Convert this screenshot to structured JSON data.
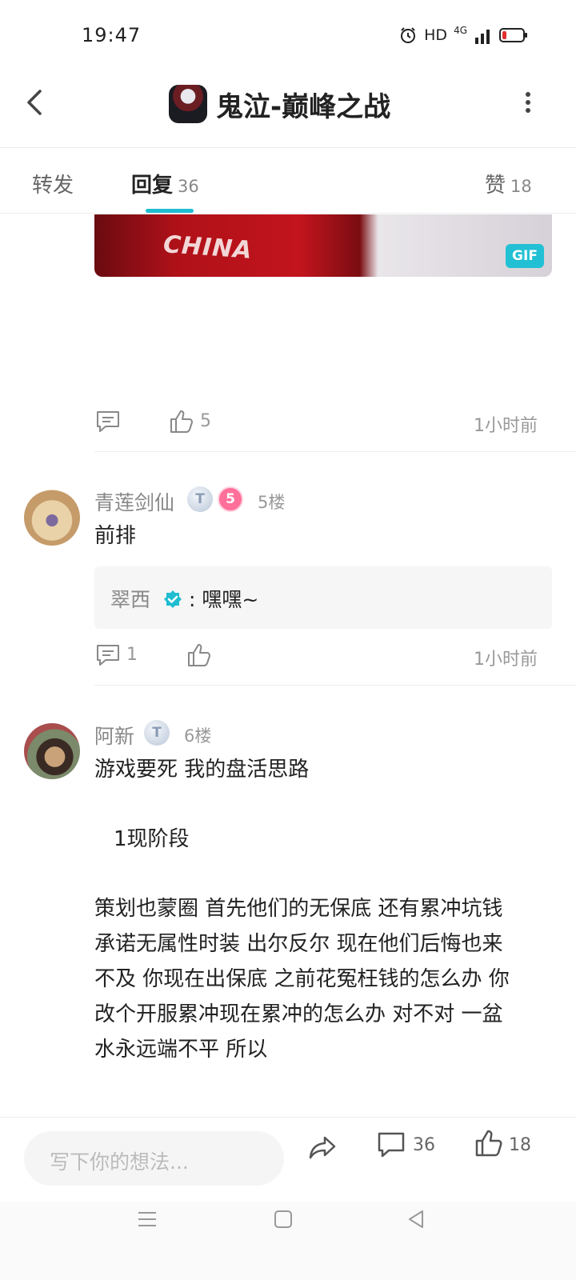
{
  "status_bar": {
    "time": "19:47",
    "hd": "HD",
    "signal": "4G"
  },
  "header": {
    "title": "鬼泣-巅峰之战"
  },
  "tabs": [
    {
      "label": "转发",
      "count": ""
    },
    {
      "label": "回复",
      "count": "36"
    },
    {
      "label": "赞",
      "count": "18"
    }
  ],
  "gif": {
    "text": "CHINA",
    "badge": "GIF"
  },
  "post4": {
    "like_count": "5",
    "time": "1小时前"
  },
  "comment5": {
    "username": "青莲剑仙",
    "badge_t": "T",
    "badge_level": "5",
    "floor": "5楼",
    "text": "前排",
    "reply": {
      "name": "翠西",
      "text": ": 嘿嘿~"
    },
    "comment_count": "1",
    "time": "1小时前"
  },
  "comment6": {
    "username": "阿新",
    "badge_t": "T",
    "floor": "6楼",
    "lines": [
      "游戏要死 我的盘活思路",
      "1现阶段",
      "策划也蒙圈 首先他们的无保底 还有累冲坑钱",
      "承诺无属性时装 出尔反尔 现在他们后悔也来",
      "不及 你现在出保底 之前花冤枉钱的怎么办 你",
      "改个开服累冲现在累冲的怎么办 对不对 一盆",
      "水永远端不平 所以"
    ]
  },
  "bottom_bar": {
    "input_placeholder": "写下你的想法...",
    "comment_count": "36",
    "like_count": "18"
  },
  "colors": {
    "accent": "#20bdd1",
    "muted": "#999999"
  }
}
